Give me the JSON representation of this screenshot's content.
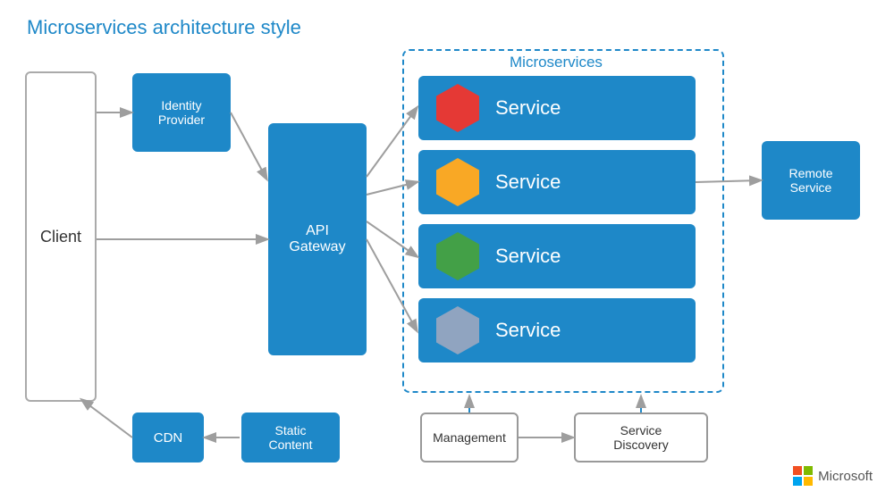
{
  "title": "Microservices architecture style",
  "microservices_label": "Microservices",
  "client": "Client",
  "identity_provider": "Identity\nProvider",
  "api_gateway": "API\nGateway",
  "services": [
    {
      "label": "Service",
      "hex_color": "red"
    },
    {
      "label": "Service",
      "hex_color": "yellow"
    },
    {
      "label": "Service",
      "hex_color": "green"
    },
    {
      "label": "Service",
      "hex_color": "blue"
    }
  ],
  "remote_service": "Remote\nService",
  "cdn": "CDN",
  "static_content": "Static\nContent",
  "management": "Management",
  "service_discovery": "Service\nDiscovery",
  "microsoft": "Microsoft",
  "arrow_color": "#9e9e9e"
}
